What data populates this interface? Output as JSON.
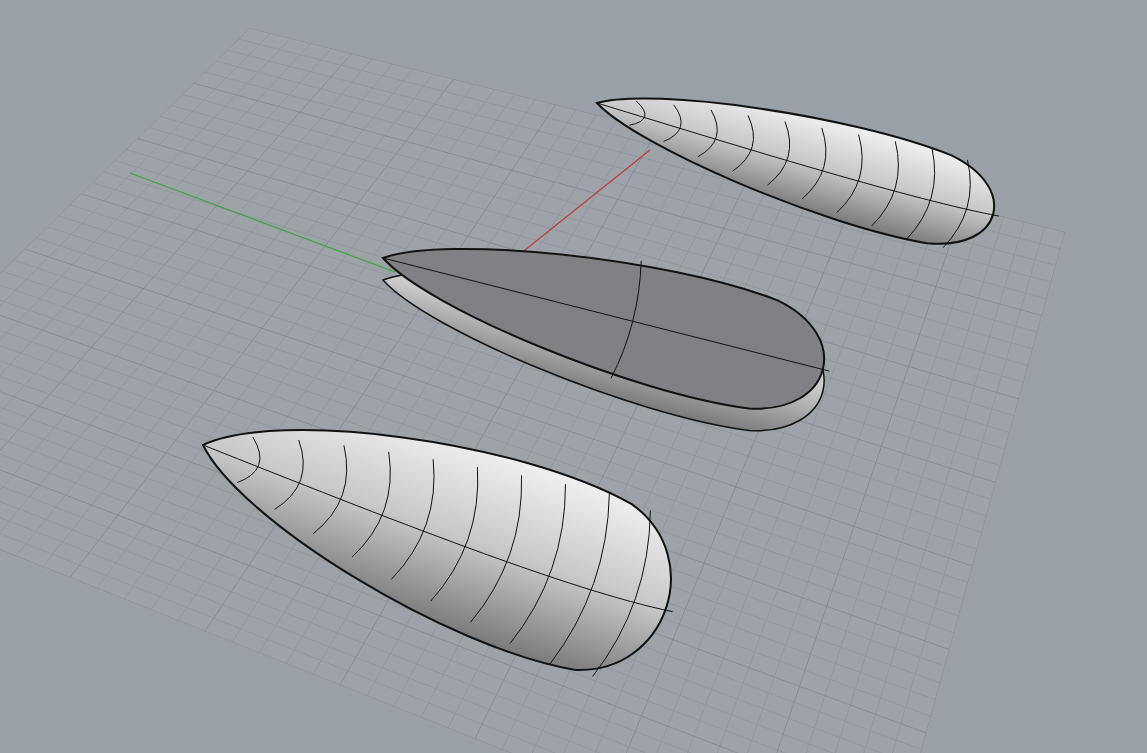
{
  "viewport": {
    "objects": [
      {
        "kind": "ribbed"
      },
      {
        "kind": "flat-top"
      },
      {
        "kind": "ribbed"
      }
    ]
  }
}
